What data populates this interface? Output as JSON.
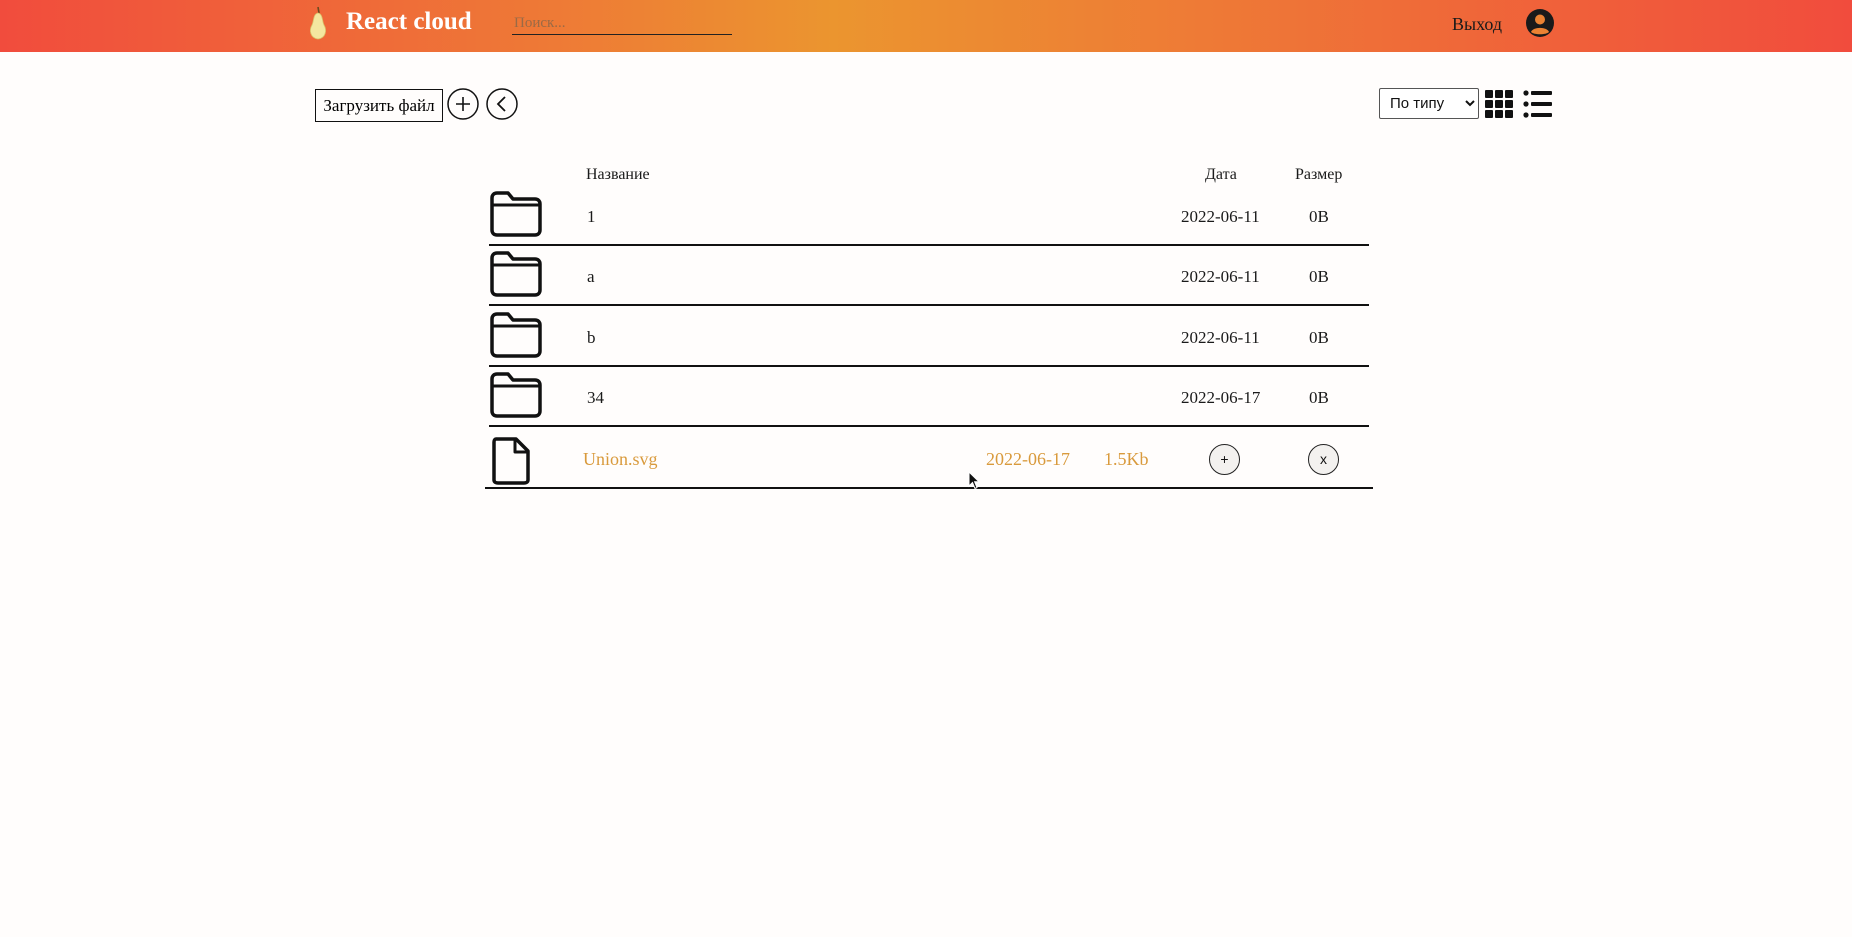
{
  "header": {
    "app_name": "React cloud",
    "search_placeholder": "Поиск...",
    "logout_label": "Выход"
  },
  "toolbar": {
    "upload_label": "Загрузить файл",
    "sort_selected": "По типу"
  },
  "table": {
    "headers": {
      "name": "Название",
      "date": "Дата",
      "size": "Размер"
    },
    "folders": [
      {
        "name": "1",
        "date": "2022-06-11",
        "size": "0B"
      },
      {
        "name": "a",
        "date": "2022-06-11",
        "size": "0B"
      },
      {
        "name": "b",
        "date": "2022-06-11",
        "size": "0B"
      },
      {
        "name": "34",
        "date": "2022-06-17",
        "size": "0B"
      }
    ],
    "file": {
      "name": "Union.svg",
      "date": "2022-06-17",
      "size": "1.5Kb",
      "download_label": "+",
      "delete_label": "x"
    }
  },
  "colors": {
    "header_gradient_start": "#f14c3d",
    "header_gradient_mid": "#eb952f",
    "file_highlight": "#d99a3c"
  },
  "icons": {
    "logo": "pear-icon",
    "user": "user-circle-icon",
    "create_folder": "plus-circle-icon",
    "back": "chevron-left-circle-icon",
    "grid_view": "grid-icon",
    "list_view": "list-icon",
    "folder": "folder-icon",
    "file": "file-icon"
  }
}
